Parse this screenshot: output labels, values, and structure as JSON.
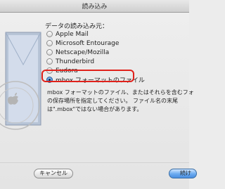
{
  "window": {
    "title": "読み込み"
  },
  "source_label": "データの読み込み元：",
  "options": [
    {
      "label": "Apple Mail",
      "selected": false
    },
    {
      "label": "Microsoft Entourage",
      "selected": false
    },
    {
      "label": "Netscape/Mozilla",
      "selected": false
    },
    {
      "label": "Thunderbird",
      "selected": false
    },
    {
      "label": "Eudora",
      "selected": false
    },
    {
      "label": "mbox フォーマットのファイル",
      "selected": true
    }
  ],
  "description": [
    "mbox フォーマットのファイル、またはそれらを含むフォ",
    "の保存場所を指定してください。 ファイル名の末尾",
    "は\".mbox\"ではない場合があります。"
  ],
  "buttons": {
    "cancel": "キャンセル",
    "continue": "続け"
  },
  "colors": {
    "highlight": "#e0211b",
    "accent": "#3d86d6"
  }
}
